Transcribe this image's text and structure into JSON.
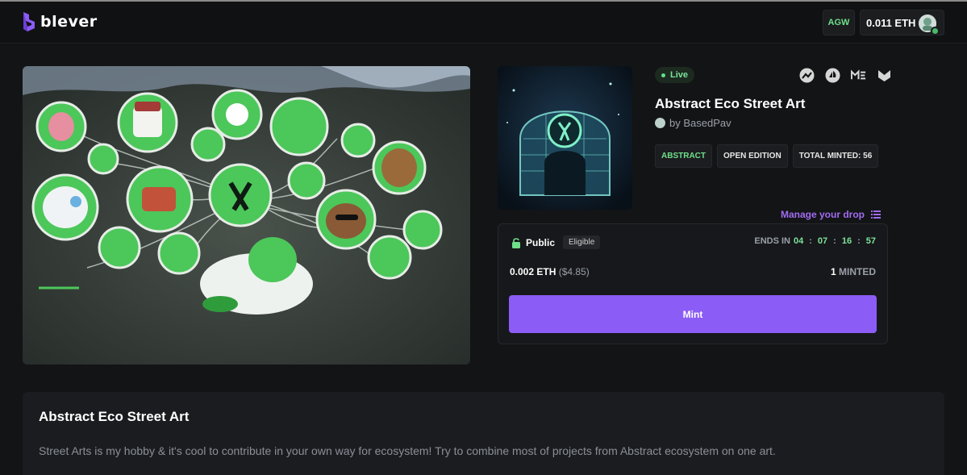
{
  "header": {
    "logo_text": "blever",
    "network_badge": "AGW",
    "wallet_balance": "0.011 ETH",
    "avatar_icon": "user-avatar-icon"
  },
  "drop": {
    "status": "Live",
    "title": "Abstract Eco Street Art",
    "creator": "by BasedPav",
    "tags": [
      "ABSTRACT",
      "OPEN EDITION",
      "TOTAL MINTED: 56"
    ],
    "social_icons": [
      "magic-eden-chart-icon",
      "opensea-icon",
      "magic-eden-icon",
      "abstract-shield-icon"
    ],
    "manage_label": "Manage your drop"
  },
  "mint": {
    "phase": "Public",
    "eligibility": "Eligible",
    "ends_label": "ENDS IN",
    "countdown": [
      "04",
      "07",
      "16",
      "57"
    ],
    "countdown_sep": ":",
    "price": "0.002 ETH",
    "price_usd": "($4.85)",
    "minted_count": "1",
    "minted_label": "MINTED",
    "button_label": "Mint"
  },
  "description": {
    "title": "Abstract Eco Street Art",
    "body": "Street Arts is my hobby & it's cool to contribute in your own way for ecosystem! Try to combine most of projects from Abstract ecosystem on one art."
  },
  "colors": {
    "accent": "#8b5cf6",
    "live_green": "#7de39a",
    "background": "#131416"
  }
}
